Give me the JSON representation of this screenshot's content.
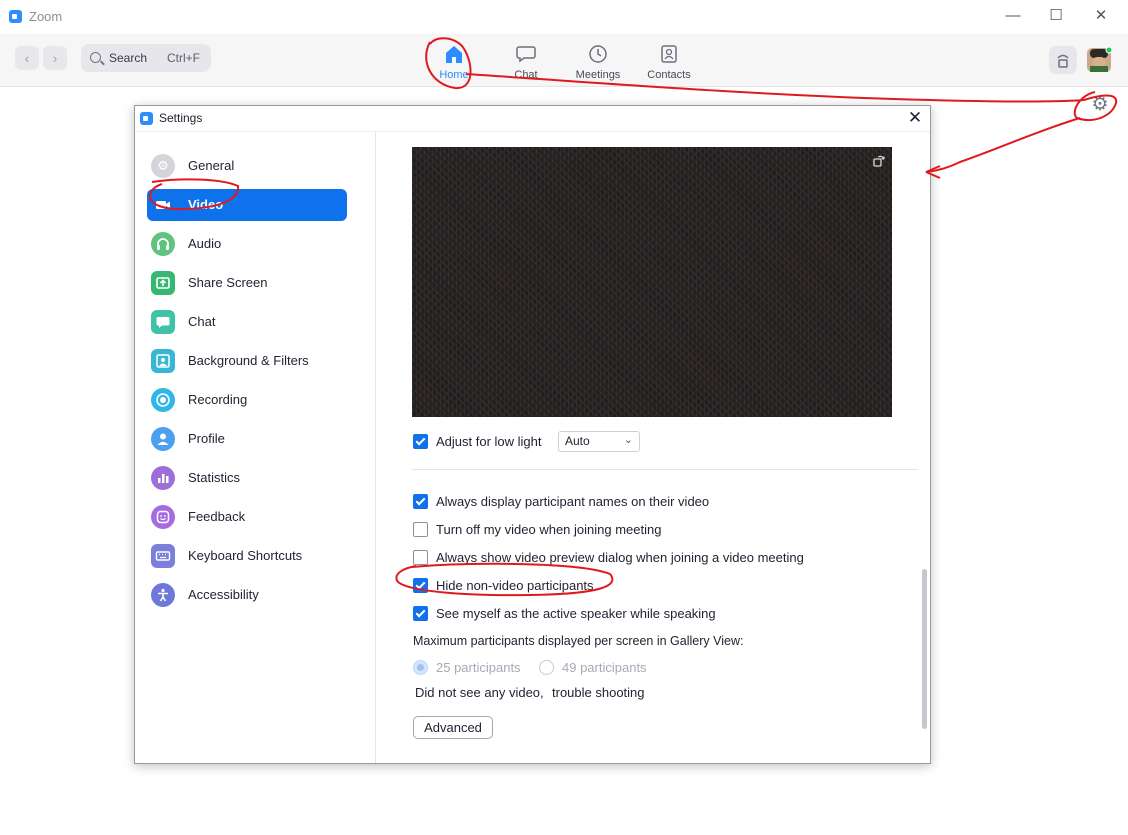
{
  "app": {
    "title": "Zoom"
  },
  "window_controls": {
    "minimize": "—",
    "maximize": "☐",
    "close": "✕"
  },
  "toolbar": {
    "search_label": "Search",
    "search_shortcut": "Ctrl+F",
    "tabs": [
      {
        "label": "Home",
        "icon": "home-icon",
        "active": true
      },
      {
        "label": "Chat",
        "icon": "chat-icon",
        "active": false
      },
      {
        "label": "Meetings",
        "icon": "clock-icon",
        "active": false
      },
      {
        "label": "Contacts",
        "icon": "contacts-icon",
        "active": false
      }
    ],
    "accent": "#2d8cff"
  },
  "settings": {
    "title": "Settings",
    "sidebar": [
      {
        "label": "General",
        "icon": "gear-icon",
        "color": "#d4d4da",
        "active": false
      },
      {
        "label": "Video",
        "icon": "video-camera-icon",
        "color": "#0e72ed",
        "active": true
      },
      {
        "label": "Audio",
        "icon": "headphones-icon",
        "color": "#5fc27e",
        "active": false
      },
      {
        "label": "Share Screen",
        "icon": "share-screen-icon",
        "color": "#37b872",
        "active": false
      },
      {
        "label": "Chat",
        "icon": "chat-bubble-icon",
        "color": "#3fc2a8",
        "active": false
      },
      {
        "label": "Background & Filters",
        "icon": "background-icon",
        "color": "#38b7d4",
        "active": false
      },
      {
        "label": "Recording",
        "icon": "recording-icon",
        "color": "#2fb6e9",
        "active": false
      },
      {
        "label": "Profile",
        "icon": "profile-icon",
        "color": "#4d9ff0",
        "active": false
      },
      {
        "label": "Statistics",
        "icon": "statistics-icon",
        "color": "#9d6fd9",
        "active": false
      },
      {
        "label": "Feedback",
        "icon": "feedback-icon",
        "color": "#a56be0",
        "active": false
      },
      {
        "label": "Keyboard Shortcuts",
        "icon": "keyboard-icon",
        "color": "#7a7fdc",
        "active": false
      },
      {
        "label": "Accessibility",
        "icon": "accessibility-icon",
        "color": "#6d78d9",
        "active": false
      }
    ],
    "video": {
      "adjust_low_light": {
        "label": "Adjust for low light",
        "checked": true,
        "select_value": "Auto"
      },
      "options": [
        {
          "label": "Always display participant names on their video",
          "checked": true
        },
        {
          "label": "Turn off my video when joining meeting",
          "checked": false
        },
        {
          "label": "Always show video preview dialog when joining a video meeting",
          "checked": false
        },
        {
          "label": "Hide non-video participants",
          "checked": true
        },
        {
          "label": "See myself as the active speaker while speaking",
          "checked": true
        }
      ],
      "gallery_heading": "Maximum participants displayed per screen in Gallery View:",
      "gallery_options": [
        {
          "label": "25 participants",
          "selected": true
        },
        {
          "label": "49 participants",
          "selected": false
        }
      ],
      "no_video_text": "Did not see any video,",
      "troubleshoot_link": "trouble shooting",
      "advanced_button": "Advanced"
    }
  }
}
